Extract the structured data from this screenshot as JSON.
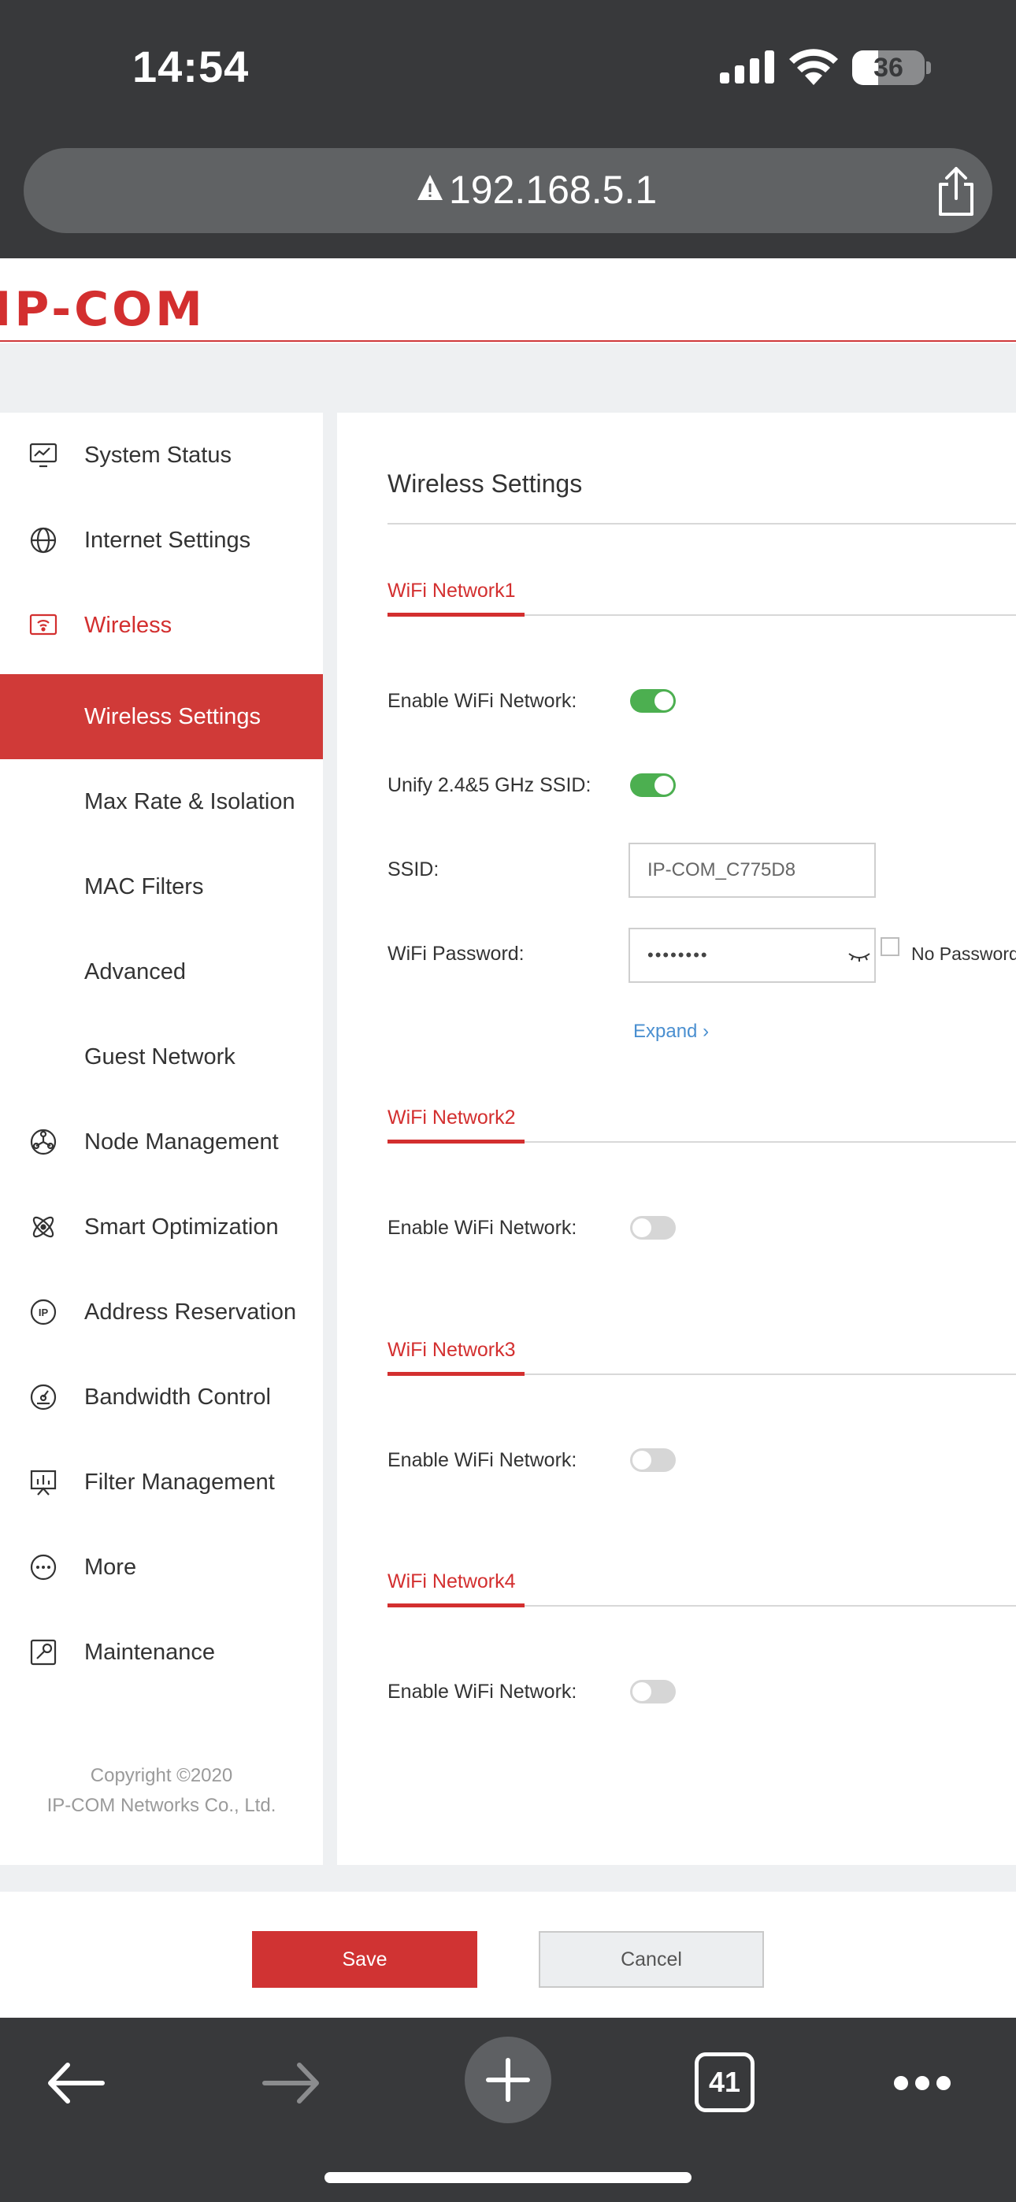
{
  "status_bar": {
    "time": "14:54",
    "battery": "36"
  },
  "address_bar": {
    "url": "192.168.5.1"
  },
  "brand": {
    "logo": "IP-COM"
  },
  "sidebar": {
    "items": [
      {
        "label": "System Status",
        "icon": "monitor-chart-icon"
      },
      {
        "label": "Internet Settings",
        "icon": "globe-icon"
      },
      {
        "label": "Wireless",
        "icon": "wireless-router-icon"
      },
      {
        "label": "Wireless Settings"
      },
      {
        "label": "Max Rate & Isolation"
      },
      {
        "label": "MAC Filters"
      },
      {
        "label": "Advanced"
      },
      {
        "label": "Guest Network"
      },
      {
        "label": "Node Management",
        "icon": "node-network-icon"
      },
      {
        "label": "Smart Optimization",
        "icon": "atom-icon"
      },
      {
        "label": "Address Reservation",
        "icon": "ip-circle-icon"
      },
      {
        "label": "Bandwidth Control",
        "icon": "gauge-icon"
      },
      {
        "label": "Filter Management",
        "icon": "presentation-board-icon"
      },
      {
        "label": "More",
        "icon": "more-circle-icon"
      },
      {
        "label": "Maintenance",
        "icon": "wrench-box-icon"
      }
    ],
    "copyright_line1": "Copyright ©2020",
    "copyright_line2": "IP-COM Networks Co., Ltd."
  },
  "main": {
    "title": "Wireless Settings",
    "network1": {
      "title": "WiFi Network1",
      "enable_label": "Enable WiFi Network:",
      "enabled": true,
      "unify_label": "Unify 2.4&5 GHz SSID:",
      "unify": true,
      "ssid_label": "SSID:",
      "ssid_value": "IP-COM_C775D8",
      "password_label": "WiFi Password:",
      "password_value": "••••••••",
      "no_password_label": "No Password",
      "expand_label": "Expand"
    },
    "network2": {
      "title": "WiFi Network2",
      "enable_label": "Enable WiFi Network:",
      "enabled": false
    },
    "network3": {
      "title": "WiFi Network3",
      "enable_label": "Enable WiFi Network:",
      "enabled": false
    },
    "network4": {
      "title": "WiFi Network4",
      "enable_label": "Enable WiFi Network:",
      "enabled": false
    }
  },
  "footer": {
    "save_label": "Save",
    "cancel_label": "Cancel"
  },
  "browser_toolbar": {
    "tab_count": "41"
  },
  "colors": {
    "accent": "#d32f2f",
    "toggle_on": "#4caf50",
    "link": "#4a8fd0"
  }
}
